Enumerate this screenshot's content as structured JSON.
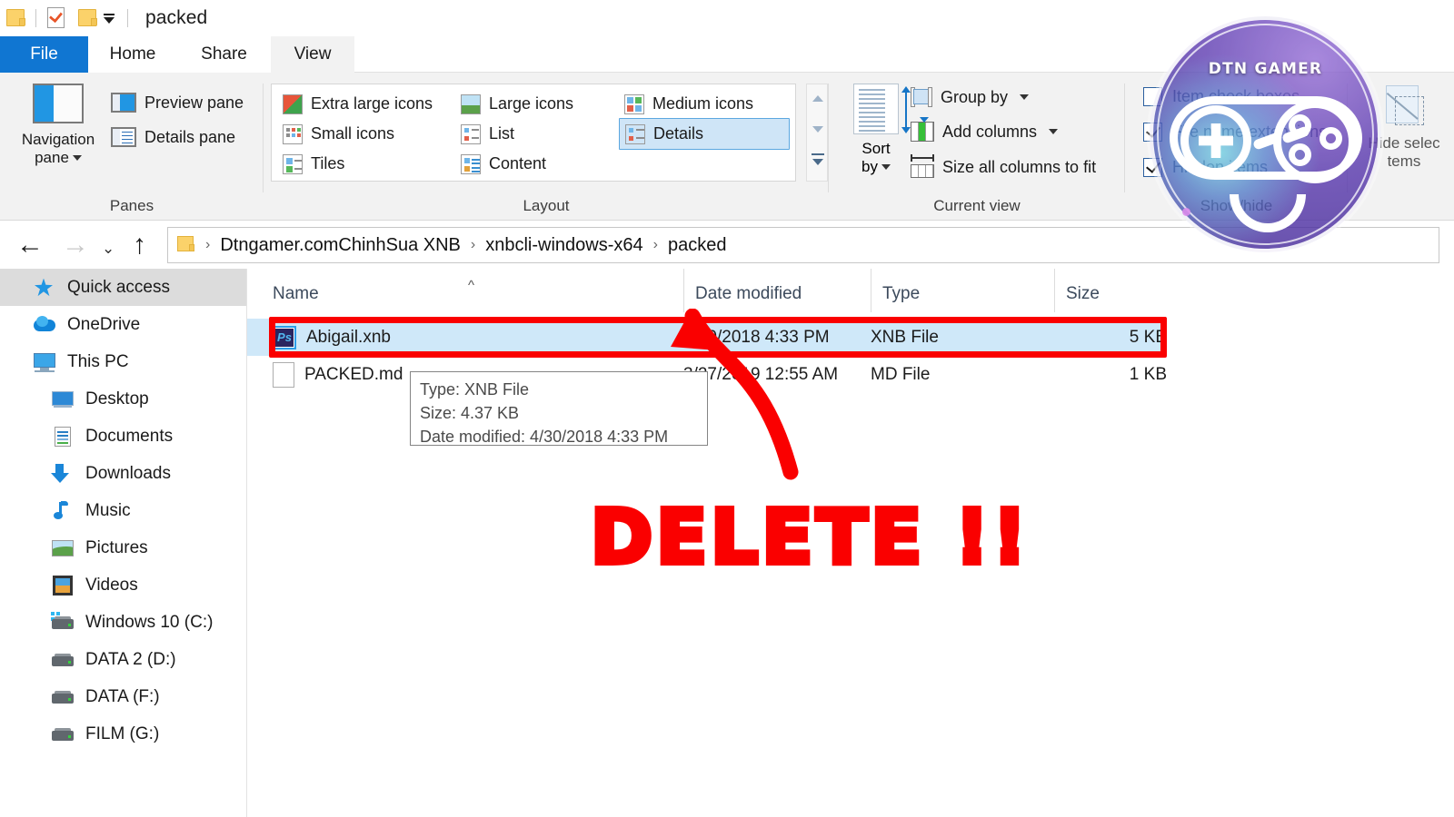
{
  "window": {
    "title": "packed",
    "quick_access": [
      "folder-icon",
      "checklist-icon",
      "folder-icon",
      "dropdown-caret"
    ]
  },
  "tabs": [
    {
      "label": "File",
      "active": false,
      "accent": "#1076d2"
    },
    {
      "label": "Home",
      "active": false
    },
    {
      "label": "Share",
      "active": false
    },
    {
      "label": "View",
      "active": true
    }
  ],
  "ribbon": {
    "groups": [
      {
        "name": "Panes",
        "label": "Panes",
        "big_button": {
          "label_line1": "Navigation",
          "label_line2": "pane",
          "has_caret": true
        },
        "items": [
          {
            "label": "Preview pane"
          },
          {
            "label": "Details pane"
          }
        ]
      },
      {
        "name": "Layout",
        "label": "Layout",
        "items": [
          {
            "label": "Extra large icons",
            "selected": false
          },
          {
            "label": "Large icons",
            "selected": false
          },
          {
            "label": "Medium icons",
            "selected": false
          },
          {
            "label": "Small icons",
            "selected": false
          },
          {
            "label": "List",
            "selected": false
          },
          {
            "label": "Details",
            "selected": true
          },
          {
            "label": "Tiles",
            "selected": false
          },
          {
            "label": "Content",
            "selected": false
          }
        ]
      },
      {
        "name": "Current view",
        "label": "Current view",
        "big_button": {
          "label_line1": "Sort",
          "label_line2": "by",
          "has_caret": true
        },
        "items": [
          {
            "label": "Group by",
            "has_caret": true
          },
          {
            "label": "Add columns",
            "has_caret": true
          },
          {
            "label": "Size all columns to fit",
            "has_caret": false
          }
        ]
      },
      {
        "name": "Show/hide",
        "label": "Show/hide",
        "checkboxes": [
          {
            "label": "Item check boxes",
            "checked": false
          },
          {
            "label": "File name extensions",
            "checked": true
          },
          {
            "label": "Hidden items",
            "checked": true
          }
        ]
      },
      {
        "name": "Options",
        "label": "",
        "big_button": {
          "label_line1": "Hide selec",
          "label_line2": "tems"
        }
      }
    ]
  },
  "address_bar": {
    "back": "←",
    "forward": "→",
    "history": "⌄",
    "up": "↑",
    "crumbs": [
      "Dtngamer.comChinhSua XNB",
      "xnbcli-windows-x64",
      "packed"
    ],
    "separator": "›"
  },
  "sidebar": {
    "items": [
      {
        "label": "Quick access",
        "icon": "pin-star-icon",
        "selected": true,
        "indent": 0
      },
      {
        "label": "OneDrive",
        "icon": "cloud-icon",
        "selected": false,
        "indent": 0
      },
      {
        "label": "This PC",
        "icon": "monitor-icon",
        "selected": false,
        "indent": 0
      },
      {
        "label": "Desktop",
        "icon": "desktop-icon",
        "selected": false,
        "indent": 1
      },
      {
        "label": "Documents",
        "icon": "document-icon",
        "selected": false,
        "indent": 1
      },
      {
        "label": "Downloads",
        "icon": "download-arrow-icon",
        "selected": false,
        "indent": 1
      },
      {
        "label": "Music",
        "icon": "music-note-icon",
        "selected": false,
        "indent": 1
      },
      {
        "label": "Pictures",
        "icon": "picture-icon",
        "selected": false,
        "indent": 1
      },
      {
        "label": "Videos",
        "icon": "video-film-icon",
        "selected": false,
        "indent": 1
      },
      {
        "label": "Windows 10 (C:)",
        "icon": "windows-drive-icon",
        "selected": false,
        "indent": 1
      },
      {
        "label": "DATA 2 (D:)",
        "icon": "drive-icon",
        "selected": false,
        "indent": 1
      },
      {
        "label": "DATA (F:)",
        "icon": "drive-icon",
        "selected": false,
        "indent": 1
      },
      {
        "label": "FILM (G:)",
        "icon": "drive-icon",
        "selected": false,
        "indent": 1
      }
    ]
  },
  "file_list": {
    "columns": [
      "Name",
      "Date modified",
      "Type",
      "Size"
    ],
    "sort_column": "Name",
    "sort_direction": "ascending",
    "rows": [
      {
        "name": "Abigail.xnb",
        "date_modified": "4/30/2018 4:33 PM",
        "type": "XNB File",
        "size": "5 KB",
        "icon": "photoshop-file-icon",
        "icon_text": "Ps",
        "selected": true
      },
      {
        "name": "PACKED.md",
        "date_modified": "3/27/2019 12:55 AM",
        "type": "MD File",
        "size": "1 KB",
        "icon": "blank-file-icon",
        "icon_text": "",
        "selected": false
      }
    ]
  },
  "tooltip": {
    "type_line": "Type: XNB File",
    "size_line": "Size: 4.37 KB",
    "date_line": "Date modified: 4/30/2018 4:33 PM"
  },
  "annotation": {
    "delete_text": "DELETE !!",
    "color": "#fa0000"
  },
  "watermark": {
    "brand": "DTN GAMER"
  }
}
